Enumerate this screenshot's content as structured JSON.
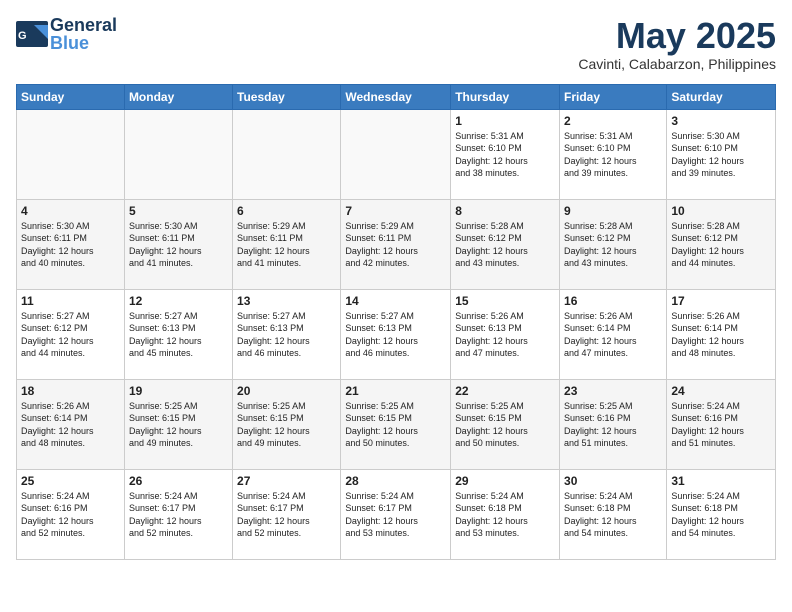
{
  "app": {
    "logo_line1": "General",
    "logo_line2": "Blue",
    "month_year": "May 2025",
    "location": "Cavinti, Calabarzon, Philippines"
  },
  "calendar": {
    "headers": [
      "Sunday",
      "Monday",
      "Tuesday",
      "Wednesday",
      "Thursday",
      "Friday",
      "Saturday"
    ],
    "weeks": [
      [
        {
          "day": "",
          "content": ""
        },
        {
          "day": "",
          "content": ""
        },
        {
          "day": "",
          "content": ""
        },
        {
          "day": "",
          "content": ""
        },
        {
          "day": "1",
          "content": "Sunrise: 5:31 AM\nSunset: 6:10 PM\nDaylight: 12 hours\nand 38 minutes."
        },
        {
          "day": "2",
          "content": "Sunrise: 5:31 AM\nSunset: 6:10 PM\nDaylight: 12 hours\nand 39 minutes."
        },
        {
          "day": "3",
          "content": "Sunrise: 5:30 AM\nSunset: 6:10 PM\nDaylight: 12 hours\nand 39 minutes."
        }
      ],
      [
        {
          "day": "4",
          "content": "Sunrise: 5:30 AM\nSunset: 6:11 PM\nDaylight: 12 hours\nand 40 minutes."
        },
        {
          "day": "5",
          "content": "Sunrise: 5:30 AM\nSunset: 6:11 PM\nDaylight: 12 hours\nand 41 minutes."
        },
        {
          "day": "6",
          "content": "Sunrise: 5:29 AM\nSunset: 6:11 PM\nDaylight: 12 hours\nand 41 minutes."
        },
        {
          "day": "7",
          "content": "Sunrise: 5:29 AM\nSunset: 6:11 PM\nDaylight: 12 hours\nand 42 minutes."
        },
        {
          "day": "8",
          "content": "Sunrise: 5:28 AM\nSunset: 6:12 PM\nDaylight: 12 hours\nand 43 minutes."
        },
        {
          "day": "9",
          "content": "Sunrise: 5:28 AM\nSunset: 6:12 PM\nDaylight: 12 hours\nand 43 minutes."
        },
        {
          "day": "10",
          "content": "Sunrise: 5:28 AM\nSunset: 6:12 PM\nDaylight: 12 hours\nand 44 minutes."
        }
      ],
      [
        {
          "day": "11",
          "content": "Sunrise: 5:27 AM\nSunset: 6:12 PM\nDaylight: 12 hours\nand 44 minutes."
        },
        {
          "day": "12",
          "content": "Sunrise: 5:27 AM\nSunset: 6:13 PM\nDaylight: 12 hours\nand 45 minutes."
        },
        {
          "day": "13",
          "content": "Sunrise: 5:27 AM\nSunset: 6:13 PM\nDaylight: 12 hours\nand 46 minutes."
        },
        {
          "day": "14",
          "content": "Sunrise: 5:27 AM\nSunset: 6:13 PM\nDaylight: 12 hours\nand 46 minutes."
        },
        {
          "day": "15",
          "content": "Sunrise: 5:26 AM\nSunset: 6:13 PM\nDaylight: 12 hours\nand 47 minutes."
        },
        {
          "day": "16",
          "content": "Sunrise: 5:26 AM\nSunset: 6:14 PM\nDaylight: 12 hours\nand 47 minutes."
        },
        {
          "day": "17",
          "content": "Sunrise: 5:26 AM\nSunset: 6:14 PM\nDaylight: 12 hours\nand 48 minutes."
        }
      ],
      [
        {
          "day": "18",
          "content": "Sunrise: 5:26 AM\nSunset: 6:14 PM\nDaylight: 12 hours\nand 48 minutes."
        },
        {
          "day": "19",
          "content": "Sunrise: 5:25 AM\nSunset: 6:15 PM\nDaylight: 12 hours\nand 49 minutes."
        },
        {
          "day": "20",
          "content": "Sunrise: 5:25 AM\nSunset: 6:15 PM\nDaylight: 12 hours\nand 49 minutes."
        },
        {
          "day": "21",
          "content": "Sunrise: 5:25 AM\nSunset: 6:15 PM\nDaylight: 12 hours\nand 50 minutes."
        },
        {
          "day": "22",
          "content": "Sunrise: 5:25 AM\nSunset: 6:15 PM\nDaylight: 12 hours\nand 50 minutes."
        },
        {
          "day": "23",
          "content": "Sunrise: 5:25 AM\nSunset: 6:16 PM\nDaylight: 12 hours\nand 51 minutes."
        },
        {
          "day": "24",
          "content": "Sunrise: 5:24 AM\nSunset: 6:16 PM\nDaylight: 12 hours\nand 51 minutes."
        }
      ],
      [
        {
          "day": "25",
          "content": "Sunrise: 5:24 AM\nSunset: 6:16 PM\nDaylight: 12 hours\nand 52 minutes."
        },
        {
          "day": "26",
          "content": "Sunrise: 5:24 AM\nSunset: 6:17 PM\nDaylight: 12 hours\nand 52 minutes."
        },
        {
          "day": "27",
          "content": "Sunrise: 5:24 AM\nSunset: 6:17 PM\nDaylight: 12 hours\nand 52 minutes."
        },
        {
          "day": "28",
          "content": "Sunrise: 5:24 AM\nSunset: 6:17 PM\nDaylight: 12 hours\nand 53 minutes."
        },
        {
          "day": "29",
          "content": "Sunrise: 5:24 AM\nSunset: 6:18 PM\nDaylight: 12 hours\nand 53 minutes."
        },
        {
          "day": "30",
          "content": "Sunrise: 5:24 AM\nSunset: 6:18 PM\nDaylight: 12 hours\nand 54 minutes."
        },
        {
          "day": "31",
          "content": "Sunrise: 5:24 AM\nSunset: 6:18 PM\nDaylight: 12 hours\nand 54 minutes."
        }
      ]
    ]
  }
}
